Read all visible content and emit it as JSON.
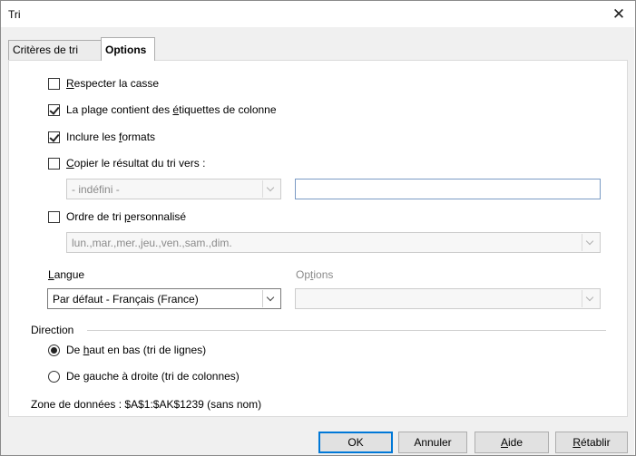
{
  "window": {
    "title": "Tri",
    "close_glyph": "✕"
  },
  "tabs": [
    {
      "label": "Critères de tri",
      "active": false
    },
    {
      "label": "Options",
      "active": true
    }
  ],
  "options": {
    "case": {
      "label_pre": "",
      "label_u": "R",
      "label_post": "especter la casse",
      "checked": false
    },
    "headers": {
      "label_pre": "La plage contient des ",
      "label_u": "é",
      "label_post": "tiquettes de colonne",
      "checked": true
    },
    "formats": {
      "label_pre": "Inclure les ",
      "label_u": "f",
      "label_post": "ormats",
      "checked": true
    },
    "copy": {
      "label_pre": "",
      "label_u": "C",
      "label_post": "opier le résultat du tri vers :",
      "checked": false
    },
    "copy_target_combo": "- indéfini -",
    "copy_target_text": "",
    "custom": {
      "label_pre": "Ordre de tri ",
      "label_u": "p",
      "label_post": "ersonnalisé",
      "checked": false
    },
    "custom_combo": "lun.,mar.,mer.,jeu.,ven.,sam.,dim."
  },
  "langue": {
    "label_u": "L",
    "label_post": "angue",
    "value": "Par défaut - Français (France)"
  },
  "lang_options": {
    "label_pre": "Op",
    "label_u": "t",
    "label_post": "ions",
    "value": ""
  },
  "direction": {
    "heading": "Direction",
    "rows": {
      "label_pre": "De ",
      "label_u": "h",
      "label_post": "aut en bas (tri de lignes)",
      "checked": true
    },
    "cols": {
      "label_pre": "De ",
      "label_u": "g",
      "label_post": "auche à droite (tri de colonnes)",
      "checked": false
    }
  },
  "zone": "Zone de données : $A$1:$AK$1239 (sans nom)",
  "buttons": {
    "ok": "OK",
    "cancel": "Annuler",
    "help": {
      "label_u": "A",
      "label_post": "ide"
    },
    "reset": {
      "label_u": "R",
      "label_post": "établir"
    }
  },
  "colors": {
    "accent": "#0078d7",
    "disabled": "#8a8a8a"
  }
}
